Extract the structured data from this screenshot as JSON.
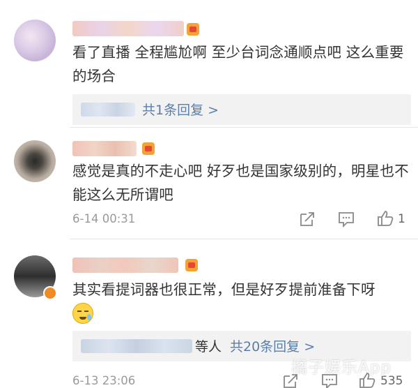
{
  "comments": [
    {
      "text": "看了直播 全程尴尬啊 至少台词念通顺点吧 这么重要的场合",
      "reply_link": "共1条回复 >"
    },
    {
      "text": "感觉是真的不走心吧 好歹也是国家级别的，明星也不能这么无所谓吧",
      "time": "6-14 00:31",
      "like_count": "1"
    },
    {
      "text": "其实看提词器也很正常，但是好歹提前准备下呀",
      "reply_prefix": "等人",
      "reply_link": "共20条回复 >",
      "time": "6-13 23:06",
      "like_count": "535"
    }
  ],
  "watermark": "橘子娱乐App",
  "icons": [
    "share-icon",
    "comment-icon",
    "like-icon",
    "verified-v-icon",
    "crown-badge-icon",
    "sweat-emoji-icon"
  ],
  "colors": {
    "link": "#5b7ea8",
    "meta": "#9a9a9a",
    "reply_bg": "#f2f2f2",
    "badge": "#f3a333"
  }
}
